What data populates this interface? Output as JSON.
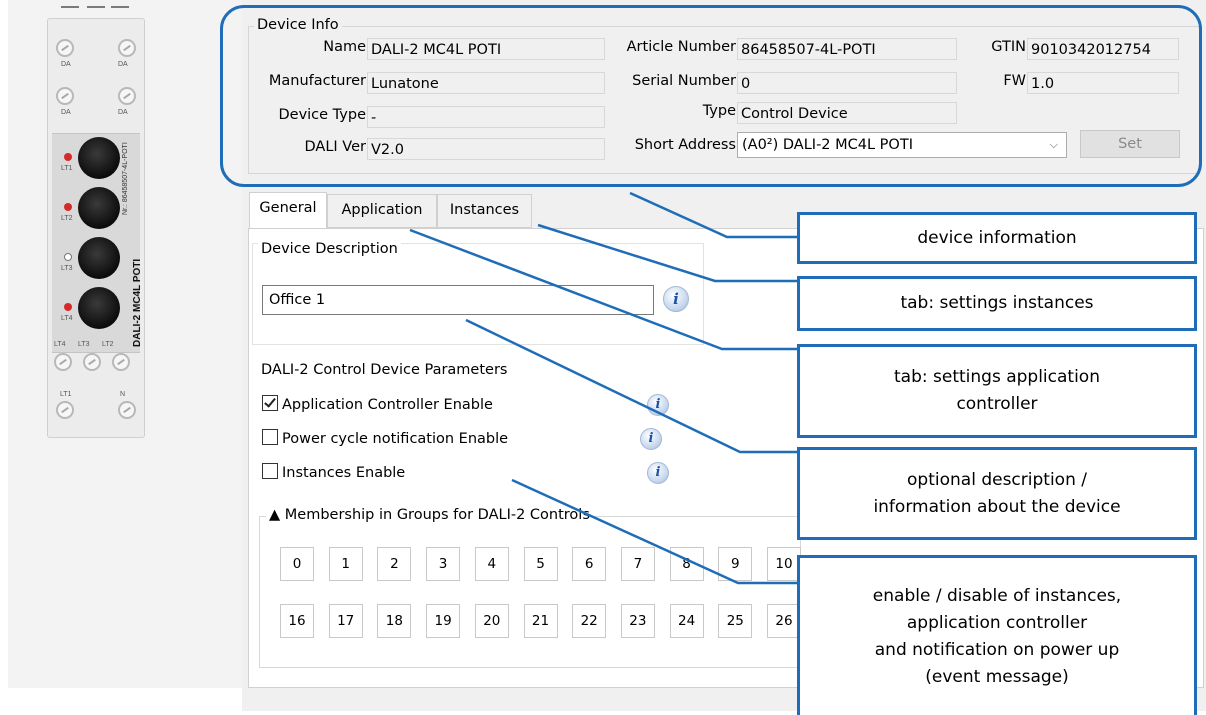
{
  "module": {
    "top_dashes": [
      "–",
      "–",
      "–"
    ],
    "term_labels_row1": [
      "DA",
      "DA"
    ],
    "term_labels_row2": [
      "DA",
      "DA"
    ],
    "led_labels": [
      "LT1",
      "LT2",
      "LT3",
      "LT4"
    ],
    "side_serial": "Nr.: 86458507-4L-POTI",
    "side_name": "DALI-2 MC4L POTI",
    "bottom_labels": [
      "LT4",
      "LT3",
      "LT2"
    ],
    "base_labels": [
      "LT1",
      "N"
    ],
    "colors": {
      "led_red": "#d62a2a",
      "led_off": "#ffffff"
    }
  },
  "device_info": {
    "group_title": "Device Info",
    "name_label": "Name",
    "name_value": "DALI-2 MC4L POTI",
    "manufacturer_label": "Manufacturer",
    "manufacturer_value": "Lunatone",
    "device_type_label": "Device Type",
    "device_type_value": "-",
    "dali_ver_label": "DALI Ver",
    "dali_ver_value": "V2.0",
    "article_label": "Article Number",
    "article_value": "86458507-4L-POTI",
    "serial_label": "Serial Number",
    "serial_value": "0",
    "type_label": "Type",
    "type_value": "Control Device",
    "short_address_label": "Short Address",
    "short_address_value": "(A0²) DALI-2 MC4L POTI",
    "gtin_label": "GTIN",
    "gtin_value": "9010342012754",
    "fw_label": "FW",
    "fw_value": "1.0",
    "set_button": "Set"
  },
  "tabs": [
    {
      "label": "General",
      "active": true
    },
    {
      "label": "Application",
      "active": false
    },
    {
      "label": "Instances",
      "active": false
    }
  ],
  "general": {
    "description_title": "Device Description",
    "description_value": "Office 1",
    "params_title": "DALI-2 Control Device Parameters",
    "checkboxes": [
      {
        "label": "Application Controller Enable",
        "checked": true
      },
      {
        "label": "Power cycle notification Enable",
        "checked": false
      },
      {
        "label": "Instances Enable",
        "checked": false
      }
    ],
    "groups_title": "▲ Membership in Groups for DALI-2 Controls",
    "groups_row1": [
      "0",
      "1",
      "2",
      "3",
      "4",
      "5",
      "6",
      "7",
      "8",
      "9",
      "10"
    ],
    "groups_row2": [
      "16",
      "17",
      "18",
      "19",
      "20",
      "21",
      "22",
      "23",
      "24",
      "25",
      "26"
    ],
    "info_glyph": "i"
  },
  "callouts": [
    "device information",
    "tab: settings instances",
    "tab: settings application\ncontroller",
    "optional description /\ninformation about the device",
    "enable / disable of instances,\napplication controller\nand notification on power up\n(event message)"
  ],
  "colors": {
    "accent": "#1f6db8",
    "dialog_bg": "#f0f0f0"
  }
}
